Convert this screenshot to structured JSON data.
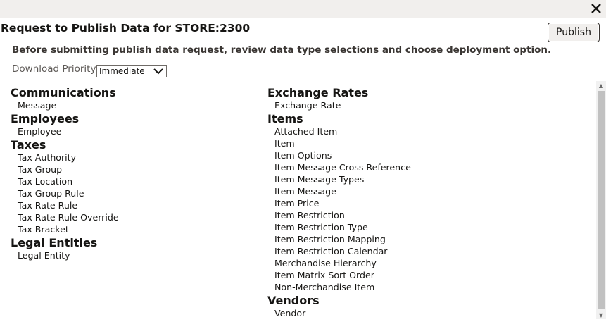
{
  "header": {
    "close_icon": "close-icon",
    "title": "Request to Publish Data for STORE:2300",
    "publish_label": "Publish"
  },
  "instructions": "Before submitting publish data request, review data type selections and choose deployment option.",
  "priority": {
    "label": "Download Priority",
    "selected": "Immediate"
  },
  "groups_left": [
    {
      "title": "Communications",
      "items": [
        "Message"
      ]
    },
    {
      "title": "Employees",
      "items": [
        "Employee"
      ]
    },
    {
      "title": "Taxes",
      "items": [
        "Tax Authority",
        "Tax Group",
        "Tax Location",
        "Tax Group Rule",
        "Tax Rate Rule",
        "Tax Rate Rule Override",
        "Tax Bracket"
      ]
    },
    {
      "title": "Legal Entities",
      "items": [
        "Legal Entity"
      ]
    }
  ],
  "groups_right": [
    {
      "title": "Exchange Rates",
      "items": [
        "Exchange Rate"
      ]
    },
    {
      "title": "Items",
      "items": [
        "Attached Item",
        "Item",
        "Item Options",
        "Item Message Cross Reference",
        "Item Message Types",
        "Item Message",
        "Item Price",
        "Item Restriction",
        "Item Restriction Type",
        "Item Restriction Mapping",
        "Item Restriction Calendar",
        "Merchandise Hierarchy",
        "Item Matrix Sort Order",
        "Non-Merchandise Item"
      ]
    },
    {
      "title": "Vendors",
      "items": [
        "Vendor"
      ]
    }
  ]
}
